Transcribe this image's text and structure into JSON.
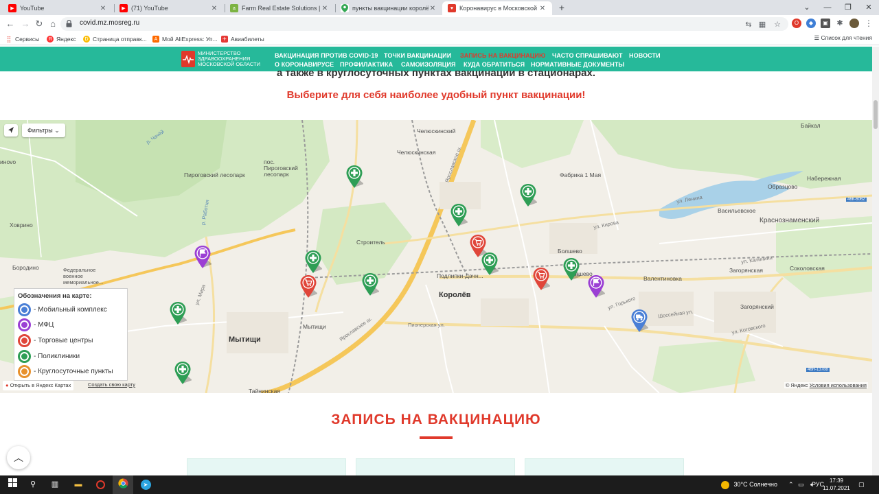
{
  "browser": {
    "tabs": [
      {
        "title": "YouTube",
        "favicon": "youtube-icon",
        "color": "#ff0000"
      },
      {
        "title": "(71) YouTube",
        "favicon": "youtube-icon",
        "color": "#ff0000"
      },
      {
        "title": "Farm Real Estate Solutions | Асто",
        "favicon": "farm-icon",
        "color": "#7cb342"
      },
      {
        "title": "пункты вакцинации королёв - Г",
        "favicon": "maps-pin-icon",
        "color": "#34a853"
      },
      {
        "title": "Коронавирус в Московской об",
        "favicon": "mosreg-icon",
        "color": "#e0392b"
      }
    ],
    "active_tab": 4,
    "url": "covid.mz.mosreg.ru",
    "bookmarks": [
      {
        "label": "Сервисы",
        "icon": "apps-grid-icon",
        "color": "#ea4335"
      },
      {
        "label": "Яндекс",
        "icon": "yandex-icon",
        "color": "#ff3333"
      },
      {
        "label": "Страница отправк...",
        "icon": "page-icon",
        "color": "#fbbc04"
      },
      {
        "label": "Мой AliExpress: Уп...",
        "icon": "aliexpress-icon",
        "color": "#ff6a00"
      },
      {
        "label": "Авиабилеты",
        "icon": "plane-icon",
        "color": "#e53935"
      }
    ],
    "reading_list": "Список для чтения"
  },
  "site": {
    "logo_text": "Министерство здравоохранения Московской области",
    "nav_row1": [
      "ВАКЦИНАЦИЯ ПРОТИВ COVID-19",
      "ТОЧКИ ВАКЦИНАЦИИ",
      "ЗАПИСЬ НА ВАКЦИНАЦИЮ",
      "ЧАСТО СПРАШИВАЮТ",
      "НОВОСТИ"
    ],
    "nav_row2": [
      "О КОРОНАВИРУСЕ",
      "ПРОФИЛАКТИКА",
      "САМОИЗОЛЯЦИЯ",
      "КУДА ОБРАТИТЬСЯ",
      "НОРМАТИВНЫЕ ДОКУМЕНТЫ"
    ],
    "nav_active": "ЗАПИСЬ НА ВАКЦИНАЦИЮ",
    "subtitle_cut": "а также в круглосуточных пунктах вакцинации в стационарах.",
    "choose_text": "Выберите для себя наиболее удобный пункт вакцинации!",
    "section_title": "ЗАПИСЬ НА ВАКЦИНАЦИЮ"
  },
  "map": {
    "filters_label": "Фильтры",
    "legend_title": "Обозначения на карте:",
    "legend": [
      {
        "label": "- Мобильный комплекс",
        "color": "#4a7fd6",
        "icon": "truck-icon"
      },
      {
        "label": "- МФЦ",
        "color": "#9b3fd4",
        "icon": "flag-icon"
      },
      {
        "label": "- Торговые центры",
        "color": "#e0463a",
        "icon": "cart-icon"
      },
      {
        "label": "- Поликлиники",
        "color": "#2e9e55",
        "icon": "plus-icon"
      },
      {
        "label": "- Круглосуточные пункты",
        "color": "#e8912e",
        "icon": "plus-icon"
      }
    ],
    "labels": {
      "pirogovsky_lesopark": "Пироговский лесопарк",
      "pos_pirogovsky": "пос. Пироговский лесопарк",
      "chelyuskinsky": "Челюскинский",
      "chelyuskinskaya": "Челюскинская",
      "fabrika": "Фабрика 1 Мая",
      "obraztsovo": "Образцово",
      "naberezhnaya": "Набережная",
      "vasilevskoe": "Васильевское",
      "krasnoznamensky": "Краснознаменский",
      "khovrino": "Ховрино",
      "borodino": "Бородино",
      "memorial": "Федеральное военное мемориальное...",
      "stroitel": "Строитель",
      "bolshevo": "Болшево",
      "bolshevo2": "Болшево",
      "podlipki": "Подлипки-Дачн...",
      "korolev": "Королёв",
      "valentinovka": "Валентиновка",
      "zagoryanskaya": "Загорянская",
      "sokolovskaya": "Соколовская",
      "zagoryansky": "Загорянский",
      "mytishchi": "Мытищи",
      "mytishchi_st": "Мытищи",
      "taininskaya": "Тайнинская",
      "baikal": "Байкал",
      "inovo": "инovo",
      "road_46k": "46К-6062",
      "road_46n": "46Н-13788",
      "ul_mira": "ул. Мира",
      "yaroslavskoe": "Ярославское ш.",
      "pionerskaya": "Пионерская ул.",
      "ul_gorkogo": "ул. Горького",
      "shosseynaya": "Шоссейная ул.",
      "ul_lenina": "ул. Ленина",
      "ul_kirova": "ул. Кирова",
      "ul_kalinina": "ул. Калинина",
      "ul_kotovskogo": "ул. Котовского",
      "r_chechera": "р. Чачёй",
      "r_rabotnya": "р. Работня",
      "yaroslavskoe2": "Ярославское ш."
    },
    "open_in_yandex": "Открыть в Яндекс Картах",
    "create_map": "Создать свою карту",
    "copyright": "© Яндекс",
    "terms": "Условия использования"
  },
  "taskbar": {
    "weather": "30°C Солнечно",
    "lang": "РУС",
    "time": "17:39",
    "date": "11.07.2021"
  }
}
